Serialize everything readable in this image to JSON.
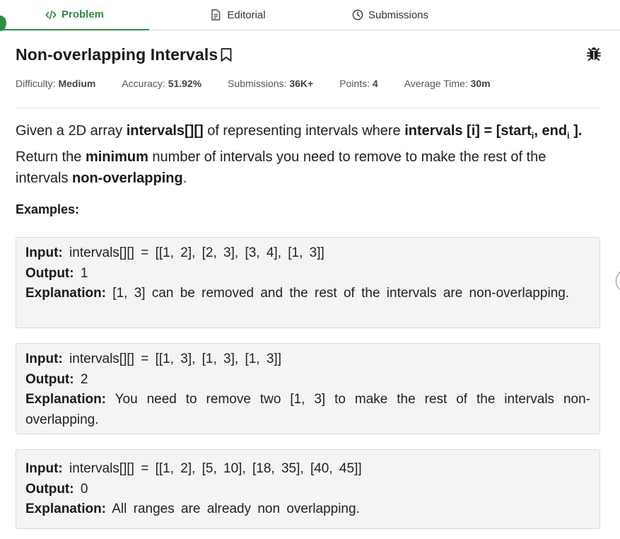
{
  "tabs": {
    "problem": "Problem",
    "editorial": "Editorial",
    "submissions": "Submissions"
  },
  "problem": {
    "title": "Non-overlapping Intervals",
    "meta": {
      "difficulty_label": "Difficulty:",
      "difficulty_value": "Medium",
      "accuracy_label": "Accuracy:",
      "accuracy_value": "51.92%",
      "submissions_label": "Submissions:",
      "submissions_value": "36K+",
      "points_label": "Points:",
      "points_value": "4",
      "avg_time_label": "Average Time:",
      "avg_time_value": "30m"
    },
    "description": {
      "p1": "Given a 2D array ",
      "b1": "intervals[][]",
      "p2": " of representing intervals where ",
      "b2": "intervals [i] = [start",
      "sub1": "i",
      "b3": ", end",
      "sub2": "i",
      "b4": " ].",
      "p3": " Return the ",
      "b5": "minimum",
      "p4": " number of intervals you need to remove to make the rest of the intervals ",
      "b6": "non-overlapping",
      "p5": "."
    },
    "examples_heading": "Examples:",
    "examples": [
      {
        "input_label": "Input:",
        "input": "intervals[][] = [[1, 2], [2, 3], [3, 4], [1, 3]]",
        "output_label": "Output:",
        "output": "1",
        "explanation_label": "Explanation:",
        "explanation": "[1, 3] can be removed and the rest of the intervals are non-overlapping."
      },
      {
        "input_label": "Input:",
        "input": "intervals[][] = [[1, 3], [1, 3], [1, 3]]",
        "output_label": "Output:",
        "output": "2",
        "explanation_label": "Explanation:",
        "explanation": "You need to remove two [1, 3] to make the rest of the intervals non-overlapping."
      },
      {
        "input_label": "Input:",
        "input": "intervals[][] = [[1, 2], [5, 10], [18, 35], [40, 45]]",
        "output_label": "Output:",
        "output": "0",
        "explanation_label": "Explanation:",
        "explanation": "All ranges are already non overlapping."
      }
    ]
  },
  "icons": {
    "problem_tab": "code-icon",
    "editorial_tab": "document-icon",
    "submissions_tab": "clock-icon",
    "bookmark": "bookmark-icon",
    "report": "bug-icon"
  },
  "colors": {
    "accent": "#2f8d46",
    "example_bg": "#f4f4f4"
  }
}
